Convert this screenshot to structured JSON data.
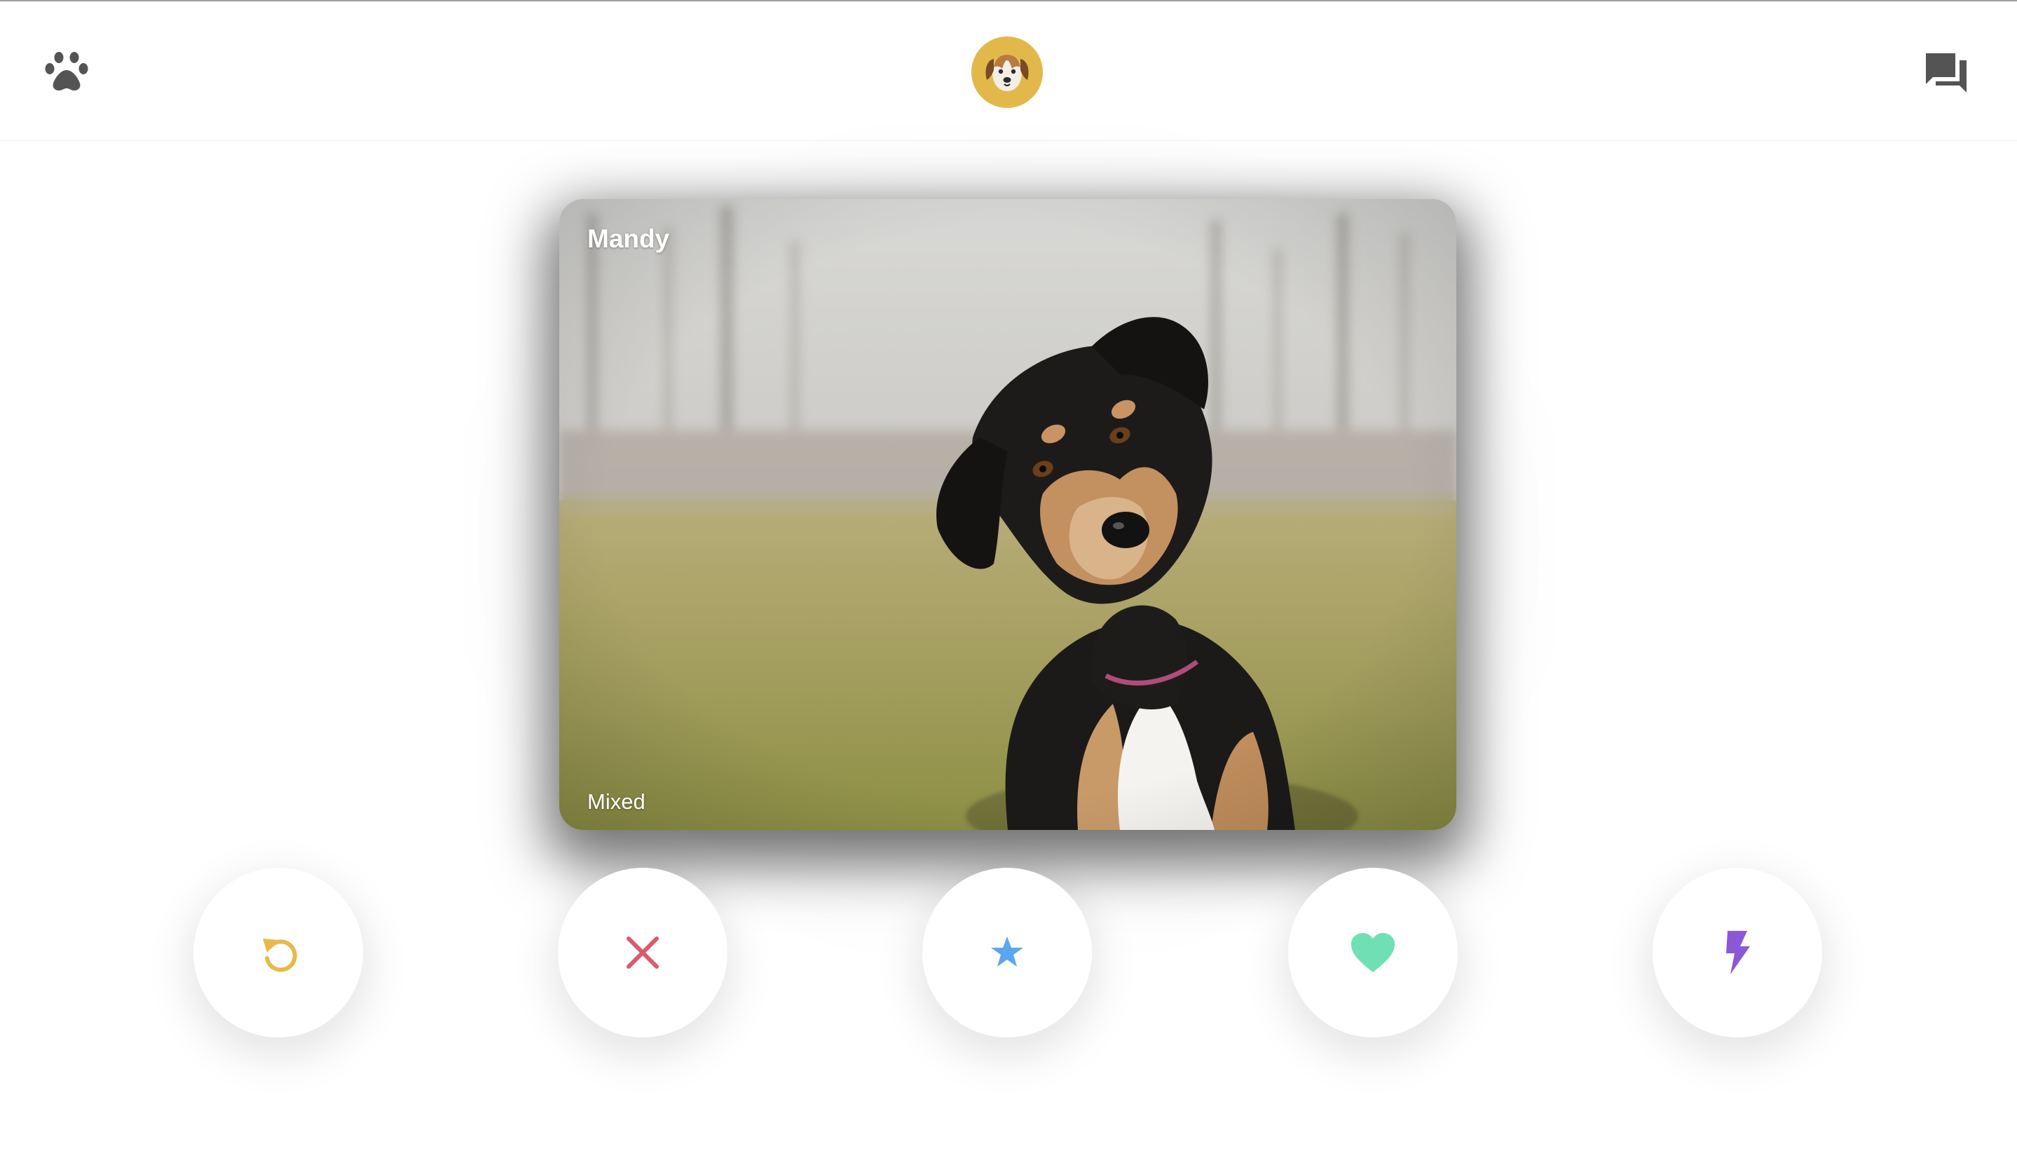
{
  "app": {
    "accent": "#e3b84b"
  },
  "header": {
    "left_icon": "paw-icon",
    "center_icon": "dog-logo-icon",
    "right_icon": "chat-icon",
    "icon_color": "#545454"
  },
  "card": {
    "name": "Mandy",
    "breed": "Mixed"
  },
  "actions": [
    {
      "id": "undo",
      "icon": "undo-icon",
      "color": "#e9b84a"
    },
    {
      "id": "nope",
      "icon": "close-icon",
      "color": "#dc5a6a"
    },
    {
      "id": "superlike",
      "icon": "star-icon",
      "color": "#5aa7ef"
    },
    {
      "id": "like",
      "icon": "heart-icon",
      "color": "#6fe0b4"
    },
    {
      "id": "boost",
      "icon": "lightning-icon",
      "color": "#8b58d6"
    }
  ]
}
